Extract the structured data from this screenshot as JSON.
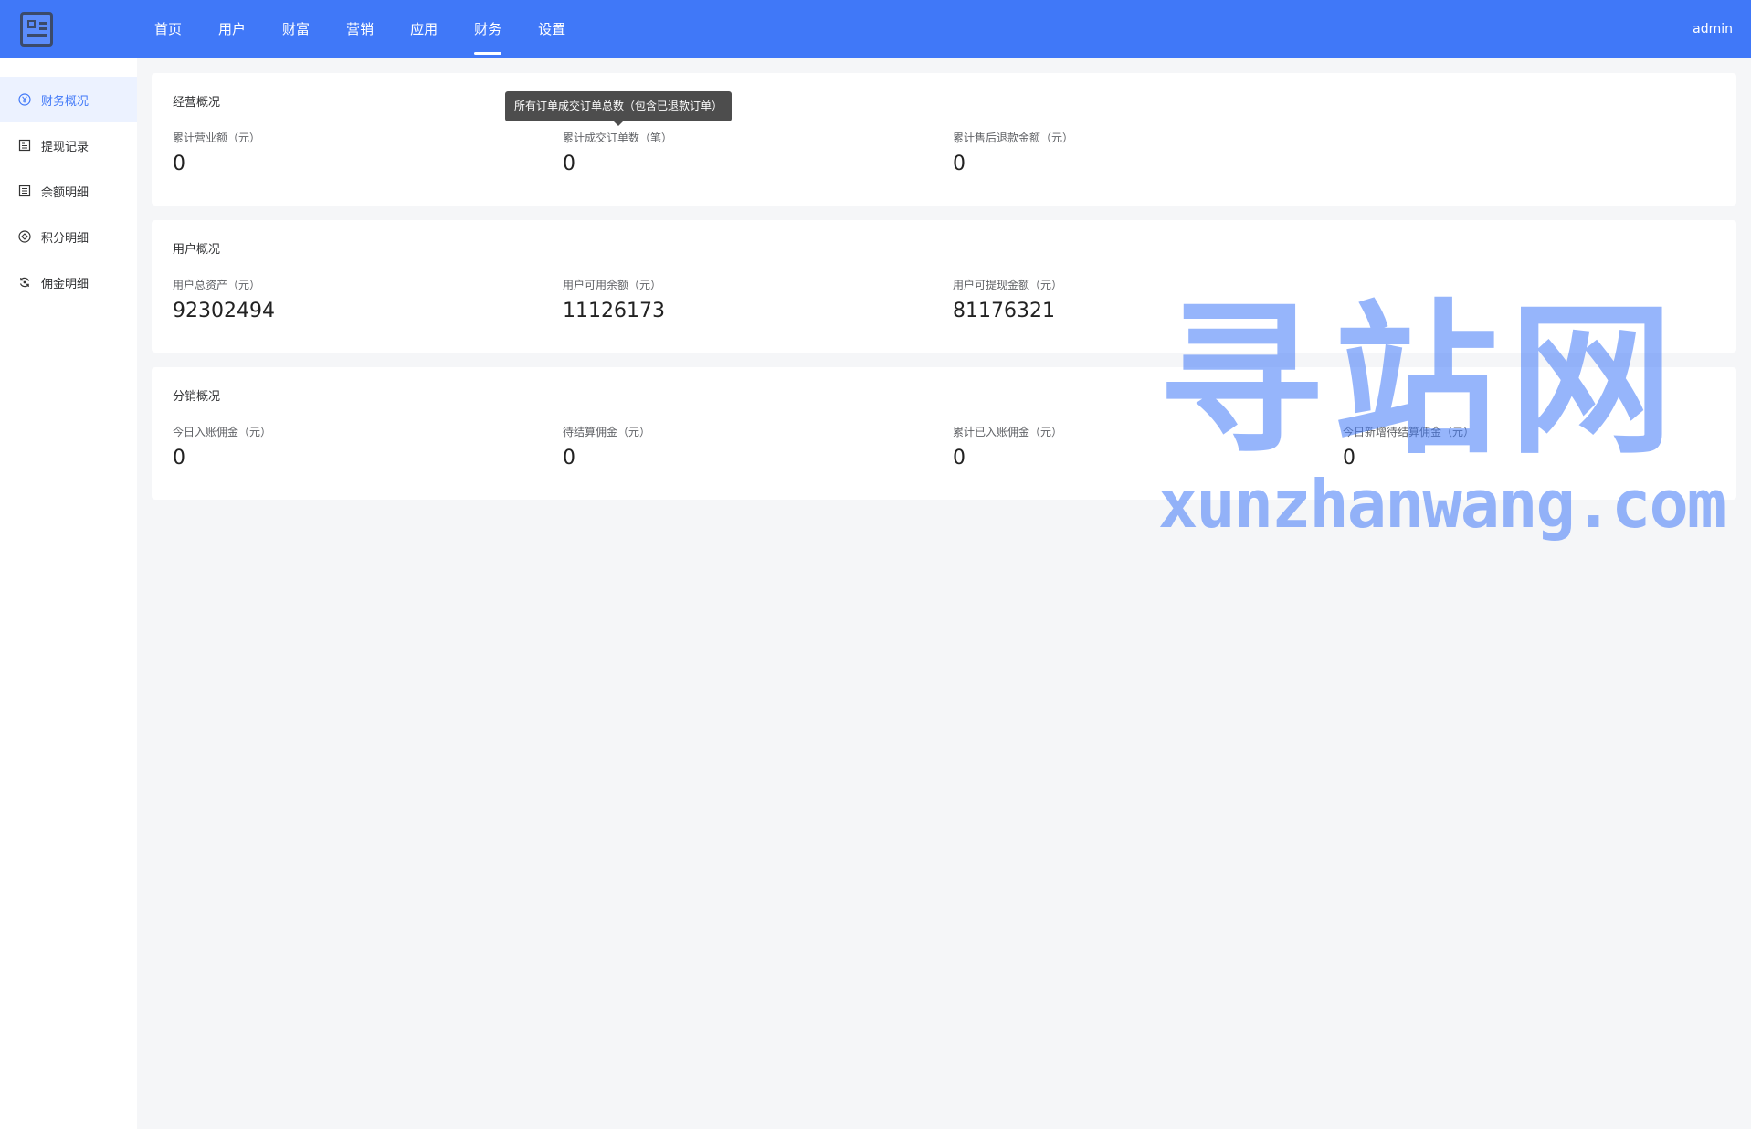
{
  "header": {
    "nav": [
      {
        "label": "首页",
        "active": false
      },
      {
        "label": "用户",
        "active": false
      },
      {
        "label": "财富",
        "active": false
      },
      {
        "label": "营销",
        "active": false
      },
      {
        "label": "应用",
        "active": false
      },
      {
        "label": "财务",
        "active": true
      },
      {
        "label": "设置",
        "active": false
      }
    ],
    "user": "admin"
  },
  "sidebar": {
    "items": [
      {
        "label": "财务概况",
        "icon": "yen-icon",
        "active": true
      },
      {
        "label": "提现记录",
        "icon": "withdraw-record-icon",
        "active": false
      },
      {
        "label": "余额明细",
        "icon": "list-icon",
        "active": false
      },
      {
        "label": "积分明细",
        "icon": "points-icon",
        "active": false
      },
      {
        "label": "佣金明细",
        "icon": "refresh-icon",
        "active": false
      }
    ]
  },
  "tooltip": "所有订单成交订单总数（包含已退款订单）",
  "cards": [
    {
      "title": "经营概况",
      "stats": [
        {
          "label": "累计营业额（元）",
          "value": "0"
        },
        {
          "label": "累计成交订单数（笔）",
          "value": "0"
        },
        {
          "label": "累计售后退款金额（元）",
          "value": "0"
        }
      ]
    },
    {
      "title": "用户概况",
      "stats": [
        {
          "label": "用户总资产（元）",
          "value": "92302494"
        },
        {
          "label": "用户可用余额（元）",
          "value": "11126173"
        },
        {
          "label": "用户可提现金额（元）",
          "value": "81176321"
        }
      ]
    },
    {
      "title": "分销概况",
      "stats": [
        {
          "label": "今日入账佣金（元）",
          "value": "0"
        },
        {
          "label": "待结算佣金（元）",
          "value": "0"
        },
        {
          "label": "累计已入账佣金（元）",
          "value": "0"
        },
        {
          "label": "今日新增待结算佣金（元）",
          "value": "0"
        }
      ]
    }
  ],
  "watermark": {
    "cn": "寻站网",
    "en": "xunzhanwang.com"
  },
  "colors": {
    "primary": "#4078f8",
    "background": "#f5f6f8",
    "sidebar_active": "#ecf2ff"
  }
}
